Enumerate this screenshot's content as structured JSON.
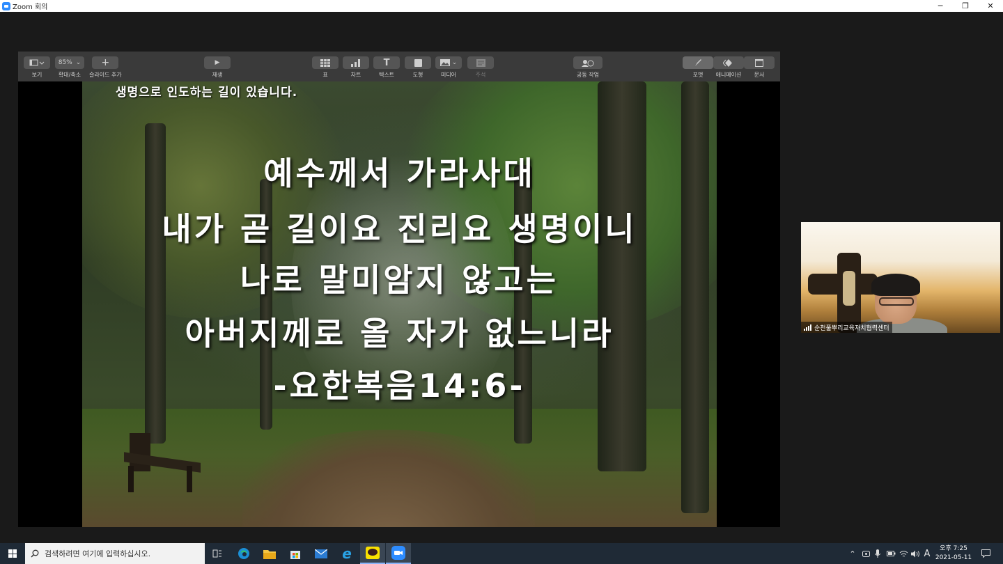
{
  "window": {
    "title": "Zoom 회의",
    "minimize": "─",
    "restore": "❐",
    "close": "✕"
  },
  "toolbar": {
    "view_label": "보기",
    "zoom_value": "85%",
    "zoom_label": "확대/축소",
    "add_slide_label": "슬라이드 추가",
    "play_label": "재생",
    "table_label": "표",
    "chart_label": "차트",
    "text_label": "텍스트",
    "shape_label": "도형",
    "media_label": "미디어",
    "comment_label": "주석",
    "collab_label": "공동 작업",
    "format_label": "포맷",
    "animate_label": "애니메이션",
    "document_label": "문서"
  },
  "slide": {
    "top_text": "생명으로 인도하는 길이 있습니다.",
    "lines": [
      "예수께서 가라사대",
      "내가 곧 길이요 진리요 생명이니",
      "나로 말미암지 않고는",
      "아버지께로 올 자가 없느니라",
      "-요한복음14:6-"
    ]
  },
  "participant": {
    "name": "순천풀뿌리교육자치협력센터"
  },
  "taskbar": {
    "search_placeholder": "검색하려면 여기에 입력하십시오.",
    "clock_time": "오후 7:25",
    "clock_date": "2021-05-11",
    "ime": "A"
  },
  "colors": {
    "toolbar_bg": "#3a3a3a",
    "taskbar_bg": "#1f2a36",
    "zoom_blue": "#2d8cff"
  }
}
